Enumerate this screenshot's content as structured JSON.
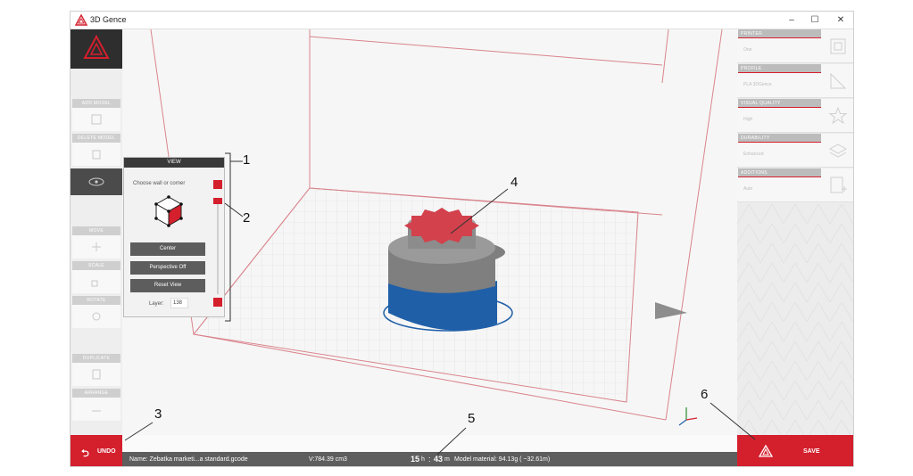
{
  "window": {
    "title": "3D Gence",
    "minimize": "–",
    "maximize": "☐",
    "close": "✕"
  },
  "left_toolbar": {
    "add_model": "ADD MODEL",
    "delete_model": "DELETE MODEL",
    "move": "MOVE",
    "scale": "SCALE",
    "rotate": "ROTATE",
    "duplicate": "DUPLICATE",
    "arrange": "ARRANGE",
    "undo": "UNDO"
  },
  "view_panel": {
    "header": "VIEW",
    "choose": "Choose wall or corner",
    "center": "Center",
    "perspective": "Perspective Off",
    "reset": "Reset View",
    "layer_label": "Layer:",
    "layer_value": "138",
    "minus": "-"
  },
  "right_panel": {
    "printer_label": "PRINTER",
    "printer_value": "One",
    "profile_label": "PROFILE",
    "profile_value": "PLA 3DGence",
    "visual_label": "VISUAL QUALITY",
    "visual_value": "High",
    "durability_label": "DURABILITY",
    "durability_value": "Enhanced",
    "additions_label": "ADDITIONS",
    "additions_value": "Auto",
    "save": "SAVE"
  },
  "status_bar": {
    "name": "Name: Zebatka marketi...a standard.gcode",
    "volume": "V:784.39 cm3",
    "hours": "15",
    "h": "h",
    "sep": ":",
    "minutes": "43",
    "m": "m",
    "material": "Model material: 94.13g ( ~32.61m)"
  },
  "callouts": {
    "c1": "1",
    "c2": "2",
    "c3": "3",
    "c4": "4",
    "c5": "5",
    "c6": "6"
  },
  "colors": {
    "accent": "#d41f2d",
    "model_gray": "#8a8a8a",
    "model_blue": "#1f5fa8",
    "dark": "#3a3a3a"
  }
}
